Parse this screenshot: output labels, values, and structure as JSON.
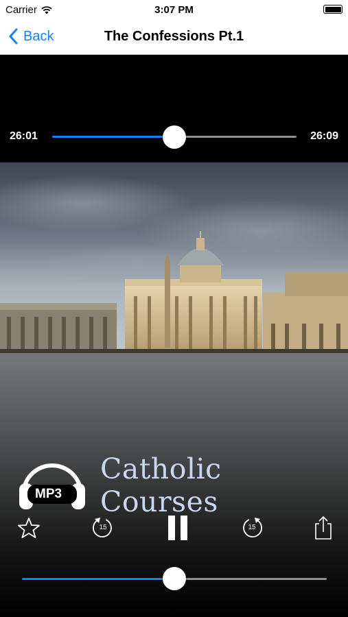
{
  "status_bar": {
    "carrier": "Carrier",
    "time": "3:07 PM"
  },
  "nav": {
    "back_label": "Back",
    "title": "The Confessions Pt.1"
  },
  "top_scrubber": {
    "elapsed": "26:01",
    "total": "26:09",
    "progress": 0.5
  },
  "artwork": {
    "badge": "MP3",
    "brand": "Catholic Courses"
  },
  "controls": {
    "skip_back_seconds": "15",
    "skip_forward_seconds": "15"
  },
  "bottom_scrubber": {
    "progress": 0.5
  },
  "colors": {
    "accent": "#1a7ff2",
    "track_remaining": "#8e8e93"
  }
}
